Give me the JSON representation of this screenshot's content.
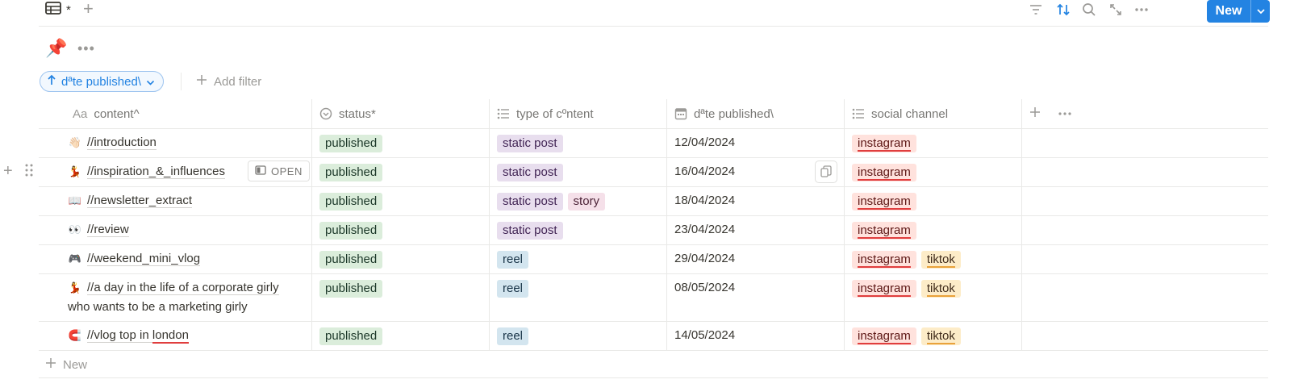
{
  "toolbar": {
    "view_name": "*",
    "add_view": "+",
    "new_label": "New",
    "icons": [
      "table-icon",
      "filter-icon",
      "sort-icon",
      "search-icon",
      "expand-icon",
      "more-icon",
      "chevron-down-icon"
    ]
  },
  "pin": {
    "emoji": "📌",
    "more": "•••"
  },
  "filters": {
    "sort_chip": "dªte published\\",
    "add_filter": "Add filter"
  },
  "columns": [
    {
      "label": "content^",
      "icon": "Aa"
    },
    {
      "label": "status*"
    },
    {
      "label": "type of cºntent"
    },
    {
      "label": "dªte published\\"
    },
    {
      "label": "social channel"
    }
  ],
  "rows": [
    {
      "emoji": "👋🏻",
      "content": "//introduction",
      "status": "published",
      "types": [
        "static post"
      ],
      "date": "12/04/2024",
      "channels": [
        "instagram"
      ]
    },
    {
      "emoji": "💃",
      "content": "//inspiration_&_influences",
      "status": "published",
      "types": [
        "static post"
      ],
      "date": "16/04/2024",
      "channels": [
        "instagram"
      ]
    },
    {
      "emoji": "📖",
      "content": "//newsletter_extract",
      "status": "published",
      "types": [
        "static post",
        "story"
      ],
      "date": "18/04/2024",
      "channels": [
        "instagram"
      ]
    },
    {
      "emoji": "👀",
      "content": "//review",
      "status": "published",
      "types": [
        "static post"
      ],
      "date": "23/04/2024",
      "channels": [
        "instagram"
      ]
    },
    {
      "emoji": "🎮",
      "content": "//weekend_mini_vlog",
      "status": "published",
      "types": [
        "reel"
      ],
      "date": "29/04/2024",
      "channels": [
        "instagram",
        "tiktok"
      ]
    },
    {
      "emoji": "💃",
      "content_line1": "//a day in the life of a corporate girly",
      "content_line2": "who wants to be a marketing girly",
      "status": "published",
      "types": [
        "reel"
      ],
      "date": "08/05/2024",
      "channels": [
        "instagram",
        "tiktok"
      ]
    },
    {
      "emoji": "🧲",
      "content_prefix": "//vlog top in ",
      "content_suffix": "london",
      "status": "published",
      "types": [
        "reel"
      ],
      "date": "14/05/2024",
      "channels": [
        "instagram",
        "tiktok"
      ]
    }
  ],
  "row_actions": {
    "open_label": "OPEN"
  },
  "new_row_label": "New",
  "colors": {
    "accent": "#2383e2",
    "status_published_bg": "#dbeddb",
    "type_static_post_bg": "#e8deee",
    "type_story_bg": "#f5e0e9",
    "type_reel_bg": "#d3e5ef",
    "channel_instagram_bg": "#ffe2dd",
    "channel_tiktok_bg": "#fdecc8"
  }
}
